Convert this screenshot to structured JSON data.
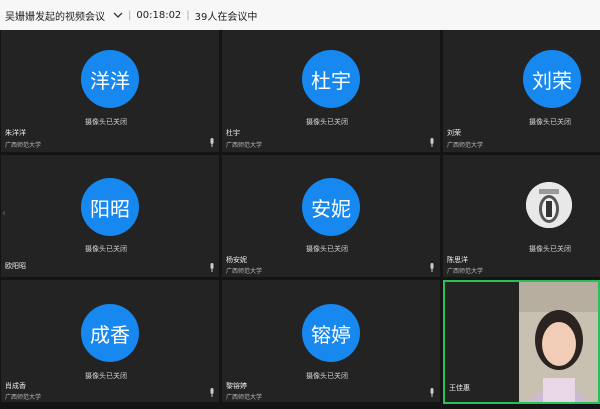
{
  "header": {
    "title": "吴姗姗发起的视频会议",
    "timer": "00:18:02",
    "separator": "|",
    "participants_status": "39人在会议中"
  },
  "tiles": [
    {
      "avatar_text": "洋洋",
      "camera_status": "摄像头已关闭",
      "name": "朱洋洋",
      "org": "广西师范大学"
    },
    {
      "avatar_text": "杜宇",
      "camera_status": "摄像头已关闭",
      "name": "杜宇",
      "org": "广西师范大学"
    },
    {
      "avatar_text": "刘荣",
      "camera_status": "摄像头已关闭",
      "name": "刘荣",
      "org": "广西师范大学"
    },
    {
      "avatar_text": "阳昭",
      "camera_status": "摄像头已关闭",
      "name": "欧阳昭",
      "org": ""
    },
    {
      "avatar_text": "安妮",
      "camera_status": "摄像头已关闭",
      "name": "杨安妮",
      "org": "广西师范大学"
    },
    {
      "avatar_text": "",
      "camera_status": "摄像头已关闭",
      "name": "陈思洋",
      "org": "广西师范大学"
    },
    {
      "avatar_text": "成香",
      "camera_status": "摄像头已关闭",
      "name": "肖成香",
      "org": "广西师范大学"
    },
    {
      "avatar_text": "镕婷",
      "camera_status": "摄像头已关闭",
      "name": "黎镕婷",
      "org": "广西师范大学"
    },
    {
      "avatar_text": "",
      "camera_status": "",
      "name": "王佳惠",
      "org": ""
    }
  ],
  "colors": {
    "avatar_blue": "#1688f0",
    "active_speaker_border": "#28c05a",
    "tile_bg": "#232323"
  }
}
